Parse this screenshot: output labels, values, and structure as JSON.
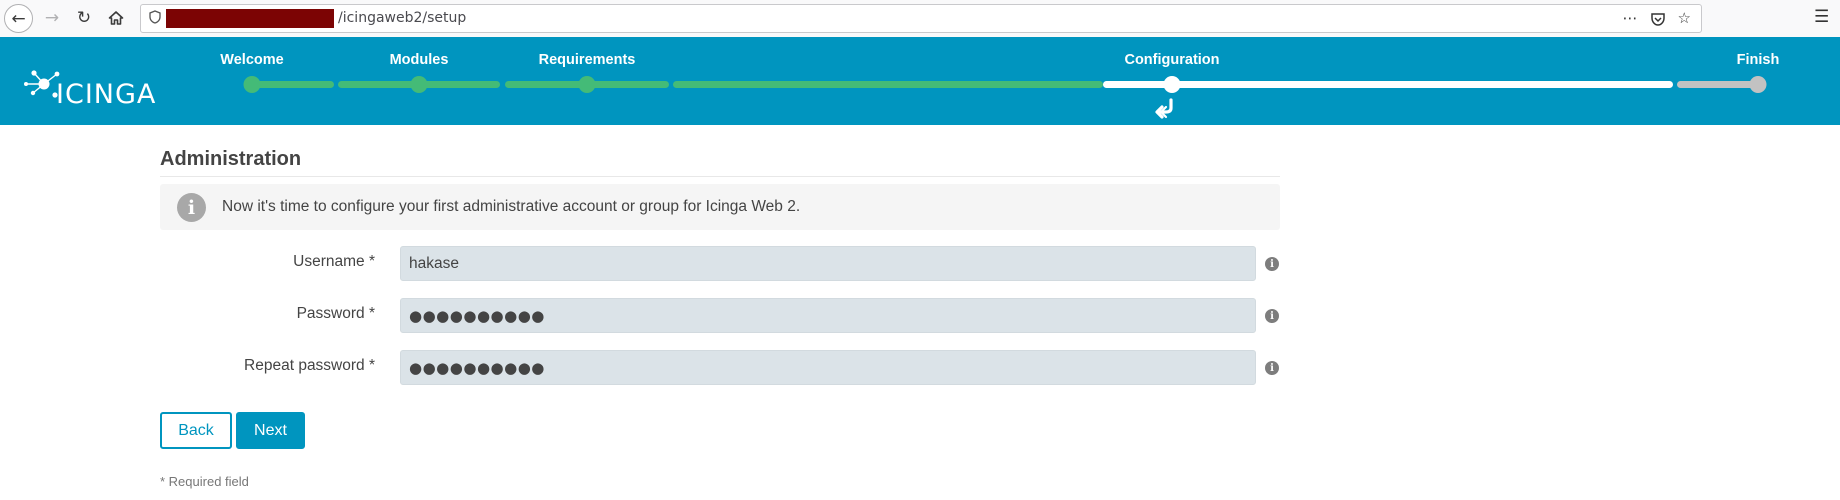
{
  "browser": {
    "url_path": "/icingaweb2/setup",
    "icons": {
      "back": "arrow-left-icon",
      "forward": "arrow-right-icon",
      "reload": "reload-icon",
      "home": "home-icon",
      "shield": "shield-icon",
      "more": "more-icon",
      "pocket": "pocket-icon",
      "bookmark": "star-icon",
      "menu": "hamburger-menu-icon"
    }
  },
  "header": {
    "logo_text": "ICINGA",
    "steps": [
      {
        "label": "Welcome",
        "state": "done"
      },
      {
        "label": "Modules",
        "state": "done"
      },
      {
        "label": "Requirements",
        "state": "done"
      },
      {
        "label": "Configuration",
        "state": "current"
      },
      {
        "label": "Finish",
        "state": "todo"
      }
    ],
    "colors": {
      "bar": "#0095bf",
      "done": "#44bb77",
      "current": "#ffffff",
      "todo": "#c2c2c2"
    }
  },
  "content": {
    "title": "Administration",
    "info": "Now it's time to configure your first administrative account or group for Icinga Web 2.",
    "fields": {
      "username": {
        "label": "Username *",
        "value": "hakase"
      },
      "password": {
        "label": "Password *",
        "value": "●●●●●●●●●●"
      },
      "repeat_password": {
        "label": "Repeat password *",
        "value": "●●●●●●●●●●"
      }
    },
    "buttons": {
      "back": "Back",
      "next": "Next"
    },
    "required_note": "* Required field"
  }
}
